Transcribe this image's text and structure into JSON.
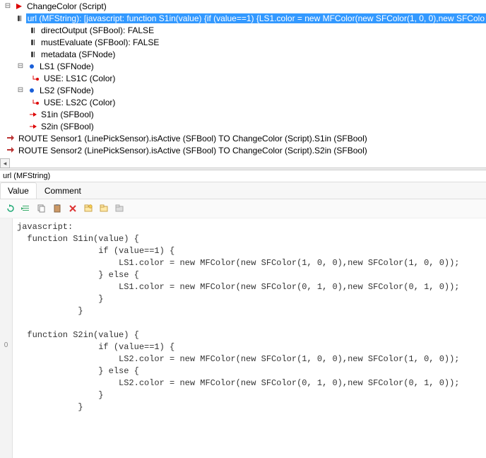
{
  "tree": {
    "root": {
      "label": "ChangeColor (Script)"
    },
    "url": {
      "label": "url (MFString): [javascript:  function S1in(value) {if (value==1) {LS1.color = new MFColor(new SFColor(1, 0, 0),new SFColo"
    },
    "directOutput": {
      "label": "directOutput (SFBool): FALSE"
    },
    "mustEvaluate": {
      "label": "mustEvaluate (SFBool): FALSE"
    },
    "metadata": {
      "label": "metadata (SFNode)"
    },
    "ls1": {
      "label": "LS1 (SFNode)"
    },
    "ls1use": {
      "label": "USE: LS1C (Color)"
    },
    "ls2": {
      "label": "LS2 (SFNode)"
    },
    "ls2use": {
      "label": "USE: LS2C (Color)"
    },
    "s1in": {
      "label": "S1in (SFBool)"
    },
    "s2in": {
      "label": "S2in (SFBool)"
    },
    "route1": {
      "label": "ROUTE Sensor1 (LinePickSensor).isActive (SFBool) TO ChangeColor (Script).S1in (SFBool)"
    },
    "route2": {
      "label": "ROUTE Sensor2 (LinePickSensor).isActive (SFBool) TO ChangeColor (Script).S2in (SFBool)"
    }
  },
  "propertyTitle": "url (MFString)",
  "tabs": {
    "value": "Value",
    "comment": "Comment"
  },
  "toolbar": {
    "undo": "undo-icon",
    "indent": "indent-icon",
    "copy": "copy-icon",
    "paste": "paste-icon",
    "delete": "delete-icon",
    "open": "open-icon",
    "folder": "folder-icon",
    "folderGray": "folder-gray-icon"
  },
  "gutterMarker": "0",
  "code": "javascript:\n  function S1in(value) {\n                if (value==1) {\n                    LS1.color = new MFColor(new SFColor(1, 0, 0),new SFColor(1, 0, 0));\n                } else {\n                    LS1.color = new MFColor(new SFColor(0, 1, 0),new SFColor(0, 1, 0));\n                }\n            }\n\n  function S2in(value) {\n                if (value==1) {\n                    LS2.color = new MFColor(new SFColor(1, 0, 0),new SFColor(1, 0, 0));\n                } else {\n                    LS2.color = new MFColor(new SFColor(0, 1, 0),new SFColor(0, 1, 0));\n                }\n            }"
}
